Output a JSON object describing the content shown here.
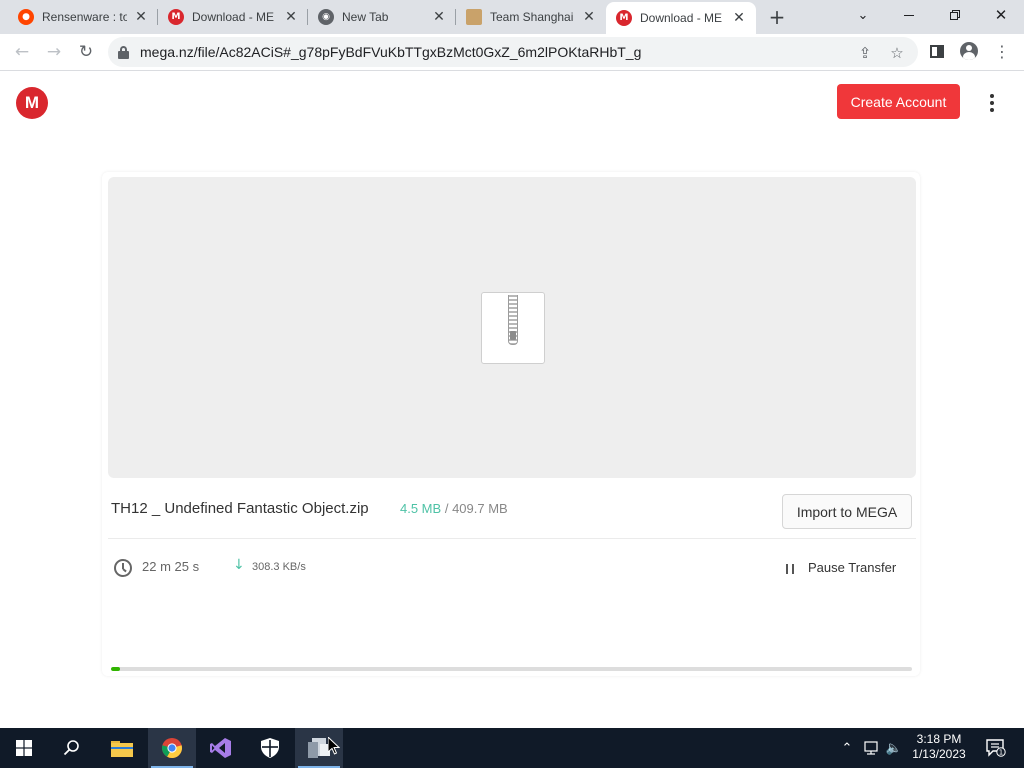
{
  "browser": {
    "tabs": [
      {
        "title": "Rensenware : to",
        "favicon": "reddit-icon",
        "active": false
      },
      {
        "title": "Download - ME",
        "favicon": "mega-icon",
        "active": false
      },
      {
        "title": "New Tab",
        "favicon": "chrome-icon",
        "active": false
      },
      {
        "title": "Team Shanghai",
        "favicon": "touhou-icon",
        "active": false
      },
      {
        "title": "Download - ME",
        "favicon": "mega-icon",
        "active": true
      }
    ],
    "url": "mega.nz/file/Ac82ACiS#_g78pFyBdFVuKbTTgxBzMct0GxZ_6m2lPOKtaRHbT_g"
  },
  "page": {
    "logo_letter": "M",
    "create_account_label": "Create Account"
  },
  "file": {
    "name": "TH12 _ Undefined Fantastic Object.zip",
    "downloaded": "4.5 MB",
    "separator": "/",
    "total": "409.7 MB",
    "import_label": "Import to MEGA"
  },
  "transfer": {
    "eta": "22 m  25 s",
    "speed": "308.3 KB/s",
    "pause_label": "Pause Transfer",
    "progress_fraction": 0.011
  },
  "taskbar": {
    "time": "3:18 PM",
    "date": "1/13/2023",
    "notification_count": "1"
  },
  "colors": {
    "mega_red": "#d9272e",
    "create_button": "#f0373a",
    "downloaded_green": "#4ec2a6",
    "progress_green": "#31b500"
  }
}
